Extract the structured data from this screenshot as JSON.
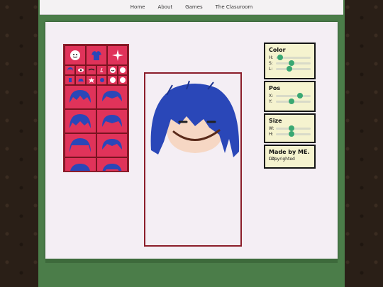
{
  "nav": [
    "Home",
    "About",
    "Games",
    "The Clasuroom"
  ],
  "panels": {
    "color": {
      "title": "Color",
      "sliders": [
        {
          "label": "H:",
          "value": 0.12
        },
        {
          "label": "S:",
          "value": 0.45
        },
        {
          "label": "L:",
          "value": 0.38
        }
      ]
    },
    "pos": {
      "title": "Pos",
      "sliders": [
        {
          "label": "X:",
          "value": 0.7
        },
        {
          "label": "Y:",
          "value": 0.45
        }
      ]
    },
    "size": {
      "title": "Size",
      "sliders": [
        {
          "label": "W:",
          "value": 0.45
        },
        {
          "label": "H:",
          "value": 0.45
        }
      ]
    },
    "credits": {
      "title": "Made by ME.",
      "line1": "Copyrighted",
      "line2": "LOL"
    }
  },
  "colors": {
    "hair": "#2a47b8",
    "skin": "#f6d7c4",
    "accent": "#e0335a",
    "frame": "#8b1d2a"
  }
}
